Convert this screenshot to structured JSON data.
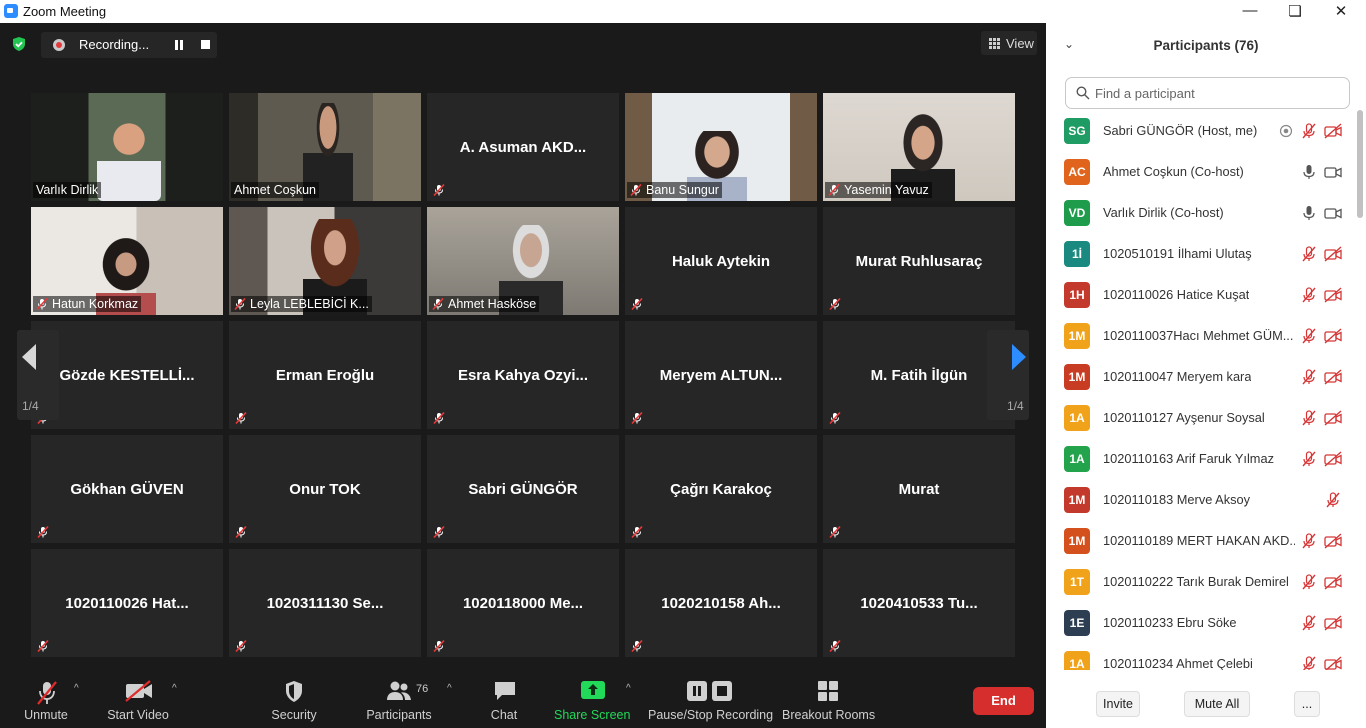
{
  "window": {
    "title": "Zoom Meeting"
  },
  "meeting": {
    "recording_label": "Recording...",
    "view_label": "View",
    "page_indicator_left": "1/4",
    "page_indicator_right": "1/4"
  },
  "colors": {
    "end": "#d62d2d",
    "share": "#23d959",
    "active_speaker": "#e3e085"
  },
  "video_tiles": [
    {
      "kind": "video",
      "caption": "Varlık Dirlik",
      "muted": false,
      "active": true
    },
    {
      "kind": "video",
      "caption": "Ahmet Coşkun",
      "muted": false
    },
    {
      "kind": "name",
      "name": "A. Asuman AKD...",
      "muted": true
    },
    {
      "kind": "video",
      "caption": "Banu Sungur",
      "muted": true
    },
    {
      "kind": "video",
      "caption": "Yasemin Yavuz",
      "muted": true
    },
    {
      "kind": "video",
      "caption": "Hatun Korkmaz",
      "muted": true
    },
    {
      "kind": "video",
      "caption": "Leyla LEBLEBİCİ K...",
      "muted": true
    },
    {
      "kind": "video",
      "caption": "Ahmet Hasköse",
      "muted": true
    },
    {
      "kind": "name",
      "name": "Haluk Aytekin",
      "muted": true
    },
    {
      "kind": "name",
      "name": "Murat Ruhlusaraç",
      "muted": true
    },
    {
      "kind": "name",
      "name": "Gözde  KESTELLİ...",
      "muted": true
    },
    {
      "kind": "name",
      "name": "Erman Eroğlu",
      "muted": true
    },
    {
      "kind": "name",
      "name": "Esra  Kahya  Ozyi...",
      "muted": true
    },
    {
      "kind": "name",
      "name": "Meryem  ALTUN...",
      "muted": true
    },
    {
      "kind": "name",
      "name": "M. Fatih İlgün",
      "muted": true
    },
    {
      "kind": "name",
      "name": "Gökhan GÜVEN",
      "muted": true
    },
    {
      "kind": "name",
      "name": "Onur TOK",
      "muted": true
    },
    {
      "kind": "name",
      "name": "Sabri GÜNGÖR",
      "muted": true
    },
    {
      "kind": "name",
      "name": "Çağrı Karakoç",
      "muted": true
    },
    {
      "kind": "name",
      "name": "Murat",
      "muted": true
    },
    {
      "kind": "name",
      "name": "1020110026 Hat...",
      "muted": true
    },
    {
      "kind": "name",
      "name": "1020311130 Se...",
      "muted": true
    },
    {
      "kind": "name",
      "name": "1020118000 Me...",
      "muted": true
    },
    {
      "kind": "name",
      "name": "1020210158 Ah...",
      "muted": true
    },
    {
      "kind": "name",
      "name": "1020410533 Tu...",
      "muted": true
    }
  ],
  "toolbar": {
    "unmute": "Unmute",
    "start_video": "Start Video",
    "security": "Security",
    "participants": "Participants",
    "participants_count": "76",
    "chat": "Chat",
    "share_screen": "Share Screen",
    "pause_stop_recording": "Pause/Stop Recording",
    "breakout_rooms": "Breakout Rooms",
    "end": "End"
  },
  "panel": {
    "title": "Participants (76)",
    "search_placeholder": "Find a participant",
    "invite": "Invite",
    "mute_all": "Mute All",
    "more": "..."
  },
  "participants": [
    {
      "initials": "SG",
      "color": "#1f9c63",
      "name": "Sabri GÜNGÖR (Host, me)",
      "mic": "muted",
      "video": "off",
      "recording": true
    },
    {
      "initials": "AC",
      "color": "#e0641b",
      "name": "Ahmet Coşkun (Co-host)",
      "mic": "on",
      "video": "on"
    },
    {
      "initials": "VD",
      "color": "#1f9c4b",
      "name": "Varlık Dirlik (Co-host)",
      "mic": "on",
      "video": "on"
    },
    {
      "initials": "1İ",
      "color": "#1a8a80",
      "name": " 1020510191 İlhami Ulutaş",
      "mic": "muted",
      "video": "off"
    },
    {
      "initials": "1H",
      "color": "#c33a2d",
      "name": "1020110026 Hatice Kuşat",
      "mic": "muted",
      "video": "off"
    },
    {
      "initials": "1M",
      "color": "#f0a31a",
      "name": "1020110037Hacı Mehmet GÜM...",
      "mic": "muted",
      "video": "off"
    },
    {
      "initials": "1M",
      "color": "#c83c23",
      "name": "1020110047 Meryem kara",
      "mic": "muted",
      "video": "off"
    },
    {
      "initials": "1A",
      "color": "#f0a31a",
      "name": "1020110127 Ayşenur Soysal",
      "mic": "muted",
      "video": "off"
    },
    {
      "initials": "1A",
      "color": "#23a34c",
      "name": "1020110163 Arif Faruk Yılmaz",
      "mic": "muted",
      "video": "off"
    },
    {
      "initials": "1M",
      "color": "#c3392b",
      "name": "1020110183 Merve Aksoy",
      "mic": "muted",
      "video": "none"
    },
    {
      "initials": "1M",
      "color": "#d4501c",
      "name": "1020110189 MERT HAKAN AKD...",
      "mic": "muted",
      "video": "off"
    },
    {
      "initials": "1T",
      "color": "#f0a31a",
      "name": "1020110222 Tarık Burak Demirel",
      "mic": "muted",
      "video": "off"
    },
    {
      "initials": "1E",
      "color": "#2e3e52",
      "name": "1020110233 Ebru Söke",
      "mic": "muted",
      "video": "off"
    },
    {
      "initials": "1A",
      "color": "#f0a31a",
      "name": "1020110234 Ahmet Çelebi",
      "mic": "muted",
      "video": "off"
    }
  ]
}
